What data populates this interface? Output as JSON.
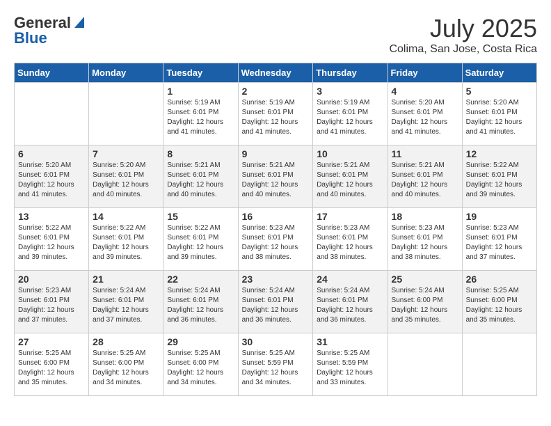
{
  "header": {
    "logo_general": "General",
    "logo_blue": "Blue",
    "month": "July 2025",
    "location": "Colima, San Jose, Costa Rica"
  },
  "days_of_week": [
    "Sunday",
    "Monday",
    "Tuesday",
    "Wednesday",
    "Thursday",
    "Friday",
    "Saturday"
  ],
  "weeks": [
    [
      {
        "day": "",
        "sunrise": "",
        "sunset": "",
        "daylight": ""
      },
      {
        "day": "",
        "sunrise": "",
        "sunset": "",
        "daylight": ""
      },
      {
        "day": "1",
        "sunrise": "Sunrise: 5:19 AM",
        "sunset": "Sunset: 6:01 PM",
        "daylight": "Daylight: 12 hours and 41 minutes."
      },
      {
        "day": "2",
        "sunrise": "Sunrise: 5:19 AM",
        "sunset": "Sunset: 6:01 PM",
        "daylight": "Daylight: 12 hours and 41 minutes."
      },
      {
        "day": "3",
        "sunrise": "Sunrise: 5:19 AM",
        "sunset": "Sunset: 6:01 PM",
        "daylight": "Daylight: 12 hours and 41 minutes."
      },
      {
        "day": "4",
        "sunrise": "Sunrise: 5:20 AM",
        "sunset": "Sunset: 6:01 PM",
        "daylight": "Daylight: 12 hours and 41 minutes."
      },
      {
        "day": "5",
        "sunrise": "Sunrise: 5:20 AM",
        "sunset": "Sunset: 6:01 PM",
        "daylight": "Daylight: 12 hours and 41 minutes."
      }
    ],
    [
      {
        "day": "6",
        "sunrise": "Sunrise: 5:20 AM",
        "sunset": "Sunset: 6:01 PM",
        "daylight": "Daylight: 12 hours and 41 minutes."
      },
      {
        "day": "7",
        "sunrise": "Sunrise: 5:20 AM",
        "sunset": "Sunset: 6:01 PM",
        "daylight": "Daylight: 12 hours and 40 minutes."
      },
      {
        "day": "8",
        "sunrise": "Sunrise: 5:21 AM",
        "sunset": "Sunset: 6:01 PM",
        "daylight": "Daylight: 12 hours and 40 minutes."
      },
      {
        "day": "9",
        "sunrise": "Sunrise: 5:21 AM",
        "sunset": "Sunset: 6:01 PM",
        "daylight": "Daylight: 12 hours and 40 minutes."
      },
      {
        "day": "10",
        "sunrise": "Sunrise: 5:21 AM",
        "sunset": "Sunset: 6:01 PM",
        "daylight": "Daylight: 12 hours and 40 minutes."
      },
      {
        "day": "11",
        "sunrise": "Sunrise: 5:21 AM",
        "sunset": "Sunset: 6:01 PM",
        "daylight": "Daylight: 12 hours and 40 minutes."
      },
      {
        "day": "12",
        "sunrise": "Sunrise: 5:22 AM",
        "sunset": "Sunset: 6:01 PM",
        "daylight": "Daylight: 12 hours and 39 minutes."
      }
    ],
    [
      {
        "day": "13",
        "sunrise": "Sunrise: 5:22 AM",
        "sunset": "Sunset: 6:01 PM",
        "daylight": "Daylight: 12 hours and 39 minutes."
      },
      {
        "day": "14",
        "sunrise": "Sunrise: 5:22 AM",
        "sunset": "Sunset: 6:01 PM",
        "daylight": "Daylight: 12 hours and 39 minutes."
      },
      {
        "day": "15",
        "sunrise": "Sunrise: 5:22 AM",
        "sunset": "Sunset: 6:01 PM",
        "daylight": "Daylight: 12 hours and 39 minutes."
      },
      {
        "day": "16",
        "sunrise": "Sunrise: 5:23 AM",
        "sunset": "Sunset: 6:01 PM",
        "daylight": "Daylight: 12 hours and 38 minutes."
      },
      {
        "day": "17",
        "sunrise": "Sunrise: 5:23 AM",
        "sunset": "Sunset: 6:01 PM",
        "daylight": "Daylight: 12 hours and 38 minutes."
      },
      {
        "day": "18",
        "sunrise": "Sunrise: 5:23 AM",
        "sunset": "Sunset: 6:01 PM",
        "daylight": "Daylight: 12 hours and 38 minutes."
      },
      {
        "day": "19",
        "sunrise": "Sunrise: 5:23 AM",
        "sunset": "Sunset: 6:01 PM",
        "daylight": "Daylight: 12 hours and 37 minutes."
      }
    ],
    [
      {
        "day": "20",
        "sunrise": "Sunrise: 5:23 AM",
        "sunset": "Sunset: 6:01 PM",
        "daylight": "Daylight: 12 hours and 37 minutes."
      },
      {
        "day": "21",
        "sunrise": "Sunrise: 5:24 AM",
        "sunset": "Sunset: 6:01 PM",
        "daylight": "Daylight: 12 hours and 37 minutes."
      },
      {
        "day": "22",
        "sunrise": "Sunrise: 5:24 AM",
        "sunset": "Sunset: 6:01 PM",
        "daylight": "Daylight: 12 hours and 36 minutes."
      },
      {
        "day": "23",
        "sunrise": "Sunrise: 5:24 AM",
        "sunset": "Sunset: 6:01 PM",
        "daylight": "Daylight: 12 hours and 36 minutes."
      },
      {
        "day": "24",
        "sunrise": "Sunrise: 5:24 AM",
        "sunset": "Sunset: 6:01 PM",
        "daylight": "Daylight: 12 hours and 36 minutes."
      },
      {
        "day": "25",
        "sunrise": "Sunrise: 5:24 AM",
        "sunset": "Sunset: 6:00 PM",
        "daylight": "Daylight: 12 hours and 35 minutes."
      },
      {
        "day": "26",
        "sunrise": "Sunrise: 5:25 AM",
        "sunset": "Sunset: 6:00 PM",
        "daylight": "Daylight: 12 hours and 35 minutes."
      }
    ],
    [
      {
        "day": "27",
        "sunrise": "Sunrise: 5:25 AM",
        "sunset": "Sunset: 6:00 PM",
        "daylight": "Daylight: 12 hours and 35 minutes."
      },
      {
        "day": "28",
        "sunrise": "Sunrise: 5:25 AM",
        "sunset": "Sunset: 6:00 PM",
        "daylight": "Daylight: 12 hours and 34 minutes."
      },
      {
        "day": "29",
        "sunrise": "Sunrise: 5:25 AM",
        "sunset": "Sunset: 6:00 PM",
        "daylight": "Daylight: 12 hours and 34 minutes."
      },
      {
        "day": "30",
        "sunrise": "Sunrise: 5:25 AM",
        "sunset": "Sunset: 5:59 PM",
        "daylight": "Daylight: 12 hours and 34 minutes."
      },
      {
        "day": "31",
        "sunrise": "Sunrise: 5:25 AM",
        "sunset": "Sunset: 5:59 PM",
        "daylight": "Daylight: 12 hours and 33 minutes."
      },
      {
        "day": "",
        "sunrise": "",
        "sunset": "",
        "daylight": ""
      },
      {
        "day": "",
        "sunrise": "",
        "sunset": "",
        "daylight": ""
      }
    ]
  ]
}
